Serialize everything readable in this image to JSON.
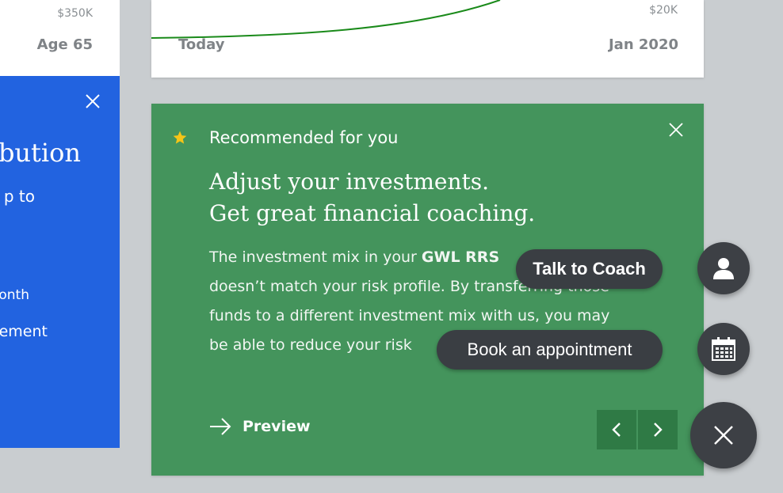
{
  "left_card": {
    "amount": "$350K",
    "age_label": "Age 65"
  },
  "left_panel": {
    "title_fragment": "bution",
    "line1_fragment": "p to",
    "line2_fragment": "onth",
    "line3_fragment": "ement"
  },
  "chart_card": {
    "y_label": "$20K",
    "x_start": "Today",
    "x_end": "Jan 2020"
  },
  "recommendation": {
    "label": "Recommended for you",
    "headline_line1": "Adjust your investments.",
    "headline_line2": "Get great financial coaching.",
    "body_prefix": "The investment mix in your ",
    "body_bold": "GWL RRS",
    "body_line2": "doesn’t match your risk profile. By transferring those",
    "body_line3": "funds to a different investment mix with us, you may",
    "body_line4": "be able to reduce your risk",
    "preview_label": "Preview"
  },
  "speed_dial": {
    "talk_to_coach_label": "Talk to Coach",
    "book_appointment_label": "Book an appointment"
  },
  "colors": {
    "green_card": "#44945c",
    "blue_panel": "#2263e0",
    "fab": "#3d4045",
    "star": "#f5c518",
    "chart_line": "#1a8a1a"
  },
  "icons": {
    "star": "star-icon",
    "close": "close-icon",
    "arrow": "arrow-right-icon",
    "prev": "chevron-left-icon",
    "next": "chevron-right-icon",
    "coach": "person-icon",
    "calendar": "calendar-icon"
  }
}
